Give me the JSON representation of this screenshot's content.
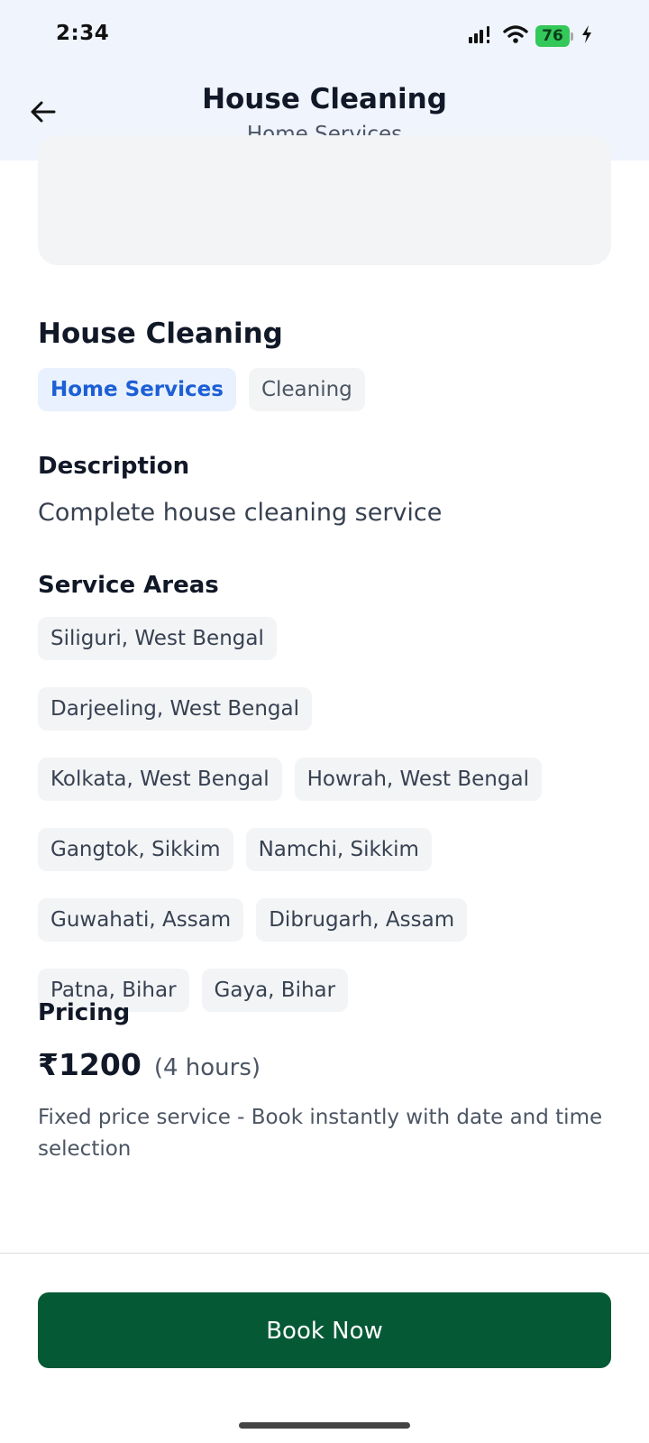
{
  "status_bar": {
    "time": "2:34",
    "battery_level": "76",
    "signal_icon": "cellular-signal-icon",
    "wifi_icon": "wifi-icon",
    "charging_icon": "charging-bolt-icon",
    "battery_color": "#34c759"
  },
  "header": {
    "back_icon": "back-arrow-icon",
    "title": "House Cleaning",
    "subtitle": "Home Services",
    "background_color": "#eff4fd"
  },
  "service": {
    "title": "House Cleaning",
    "tags": [
      {
        "label": "Home Services",
        "primary": true
      },
      {
        "label": "Cleaning",
        "primary": false
      }
    ]
  },
  "description": {
    "heading": "Description",
    "text": "Complete house cleaning service"
  },
  "service_areas": {
    "heading": "Service Areas",
    "items": [
      "Siliguri, West Bengal",
      "Darjeeling, West Bengal",
      "Kolkata, West Bengal",
      "Howrah, West Bengal",
      "Gangtok, Sikkim",
      "Namchi, Sikkim",
      "Guwahati, Assam",
      "Dibrugarh, Assam",
      "Patna, Bihar",
      "Gaya, Bihar"
    ]
  },
  "pricing": {
    "heading": "Pricing",
    "amount": "₹1200",
    "duration": "(4 hours)",
    "note": "Fixed price service - Book instantly with date and time selection"
  },
  "footer": {
    "book_label": "Book Now",
    "button_color": "#065935"
  },
  "colors": {
    "primary_tag_bg": "#e8f1fd",
    "primary_tag_text": "#1d5fd6",
    "chip_bg": "#f3f4f6"
  }
}
